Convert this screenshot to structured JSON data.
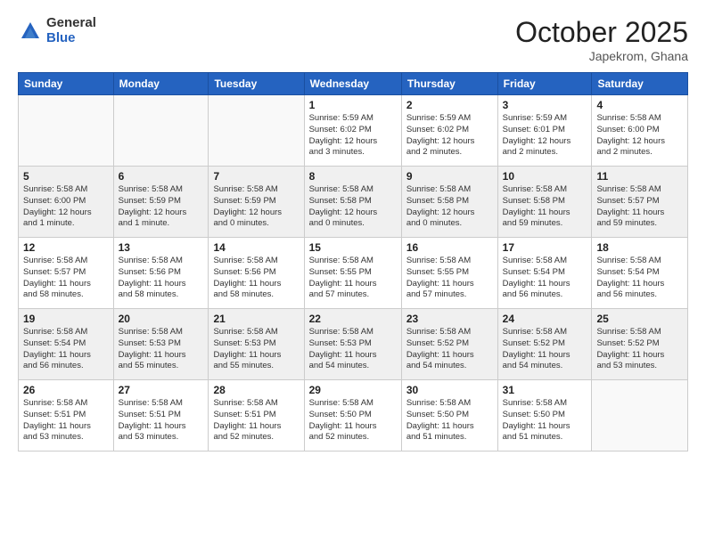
{
  "header": {
    "logo_general": "General",
    "logo_blue": "Blue",
    "month_title": "October 2025",
    "location": "Japekrom, Ghana"
  },
  "days_of_week": [
    "Sunday",
    "Monday",
    "Tuesday",
    "Wednesday",
    "Thursday",
    "Friday",
    "Saturday"
  ],
  "weeks": [
    [
      {
        "day": "",
        "info": ""
      },
      {
        "day": "",
        "info": ""
      },
      {
        "day": "",
        "info": ""
      },
      {
        "day": "1",
        "info": "Sunrise: 5:59 AM\nSunset: 6:02 PM\nDaylight: 12 hours\nand 3 minutes."
      },
      {
        "day": "2",
        "info": "Sunrise: 5:59 AM\nSunset: 6:02 PM\nDaylight: 12 hours\nand 2 minutes."
      },
      {
        "day": "3",
        "info": "Sunrise: 5:59 AM\nSunset: 6:01 PM\nDaylight: 12 hours\nand 2 minutes."
      },
      {
        "day": "4",
        "info": "Sunrise: 5:58 AM\nSunset: 6:00 PM\nDaylight: 12 hours\nand 2 minutes."
      }
    ],
    [
      {
        "day": "5",
        "info": "Sunrise: 5:58 AM\nSunset: 6:00 PM\nDaylight: 12 hours\nand 1 minute."
      },
      {
        "day": "6",
        "info": "Sunrise: 5:58 AM\nSunset: 5:59 PM\nDaylight: 12 hours\nand 1 minute."
      },
      {
        "day": "7",
        "info": "Sunrise: 5:58 AM\nSunset: 5:59 PM\nDaylight: 12 hours\nand 0 minutes."
      },
      {
        "day": "8",
        "info": "Sunrise: 5:58 AM\nSunset: 5:58 PM\nDaylight: 12 hours\nand 0 minutes."
      },
      {
        "day": "9",
        "info": "Sunrise: 5:58 AM\nSunset: 5:58 PM\nDaylight: 12 hours\nand 0 minutes."
      },
      {
        "day": "10",
        "info": "Sunrise: 5:58 AM\nSunset: 5:58 PM\nDaylight: 11 hours\nand 59 minutes."
      },
      {
        "day": "11",
        "info": "Sunrise: 5:58 AM\nSunset: 5:57 PM\nDaylight: 11 hours\nand 59 minutes."
      }
    ],
    [
      {
        "day": "12",
        "info": "Sunrise: 5:58 AM\nSunset: 5:57 PM\nDaylight: 11 hours\nand 58 minutes."
      },
      {
        "day": "13",
        "info": "Sunrise: 5:58 AM\nSunset: 5:56 PM\nDaylight: 11 hours\nand 58 minutes."
      },
      {
        "day": "14",
        "info": "Sunrise: 5:58 AM\nSunset: 5:56 PM\nDaylight: 11 hours\nand 58 minutes."
      },
      {
        "day": "15",
        "info": "Sunrise: 5:58 AM\nSunset: 5:55 PM\nDaylight: 11 hours\nand 57 minutes."
      },
      {
        "day": "16",
        "info": "Sunrise: 5:58 AM\nSunset: 5:55 PM\nDaylight: 11 hours\nand 57 minutes."
      },
      {
        "day": "17",
        "info": "Sunrise: 5:58 AM\nSunset: 5:54 PM\nDaylight: 11 hours\nand 56 minutes."
      },
      {
        "day": "18",
        "info": "Sunrise: 5:58 AM\nSunset: 5:54 PM\nDaylight: 11 hours\nand 56 minutes."
      }
    ],
    [
      {
        "day": "19",
        "info": "Sunrise: 5:58 AM\nSunset: 5:54 PM\nDaylight: 11 hours\nand 56 minutes."
      },
      {
        "day": "20",
        "info": "Sunrise: 5:58 AM\nSunset: 5:53 PM\nDaylight: 11 hours\nand 55 minutes."
      },
      {
        "day": "21",
        "info": "Sunrise: 5:58 AM\nSunset: 5:53 PM\nDaylight: 11 hours\nand 55 minutes."
      },
      {
        "day": "22",
        "info": "Sunrise: 5:58 AM\nSunset: 5:53 PM\nDaylight: 11 hours\nand 54 minutes."
      },
      {
        "day": "23",
        "info": "Sunrise: 5:58 AM\nSunset: 5:52 PM\nDaylight: 11 hours\nand 54 minutes."
      },
      {
        "day": "24",
        "info": "Sunrise: 5:58 AM\nSunset: 5:52 PM\nDaylight: 11 hours\nand 54 minutes."
      },
      {
        "day": "25",
        "info": "Sunrise: 5:58 AM\nSunset: 5:52 PM\nDaylight: 11 hours\nand 53 minutes."
      }
    ],
    [
      {
        "day": "26",
        "info": "Sunrise: 5:58 AM\nSunset: 5:51 PM\nDaylight: 11 hours\nand 53 minutes."
      },
      {
        "day": "27",
        "info": "Sunrise: 5:58 AM\nSunset: 5:51 PM\nDaylight: 11 hours\nand 53 minutes."
      },
      {
        "day": "28",
        "info": "Sunrise: 5:58 AM\nSunset: 5:51 PM\nDaylight: 11 hours\nand 52 minutes."
      },
      {
        "day": "29",
        "info": "Sunrise: 5:58 AM\nSunset: 5:50 PM\nDaylight: 11 hours\nand 52 minutes."
      },
      {
        "day": "30",
        "info": "Sunrise: 5:58 AM\nSunset: 5:50 PM\nDaylight: 11 hours\nand 51 minutes."
      },
      {
        "day": "31",
        "info": "Sunrise: 5:58 AM\nSunset: 5:50 PM\nDaylight: 11 hours\nand 51 minutes."
      },
      {
        "day": "",
        "info": ""
      }
    ]
  ]
}
